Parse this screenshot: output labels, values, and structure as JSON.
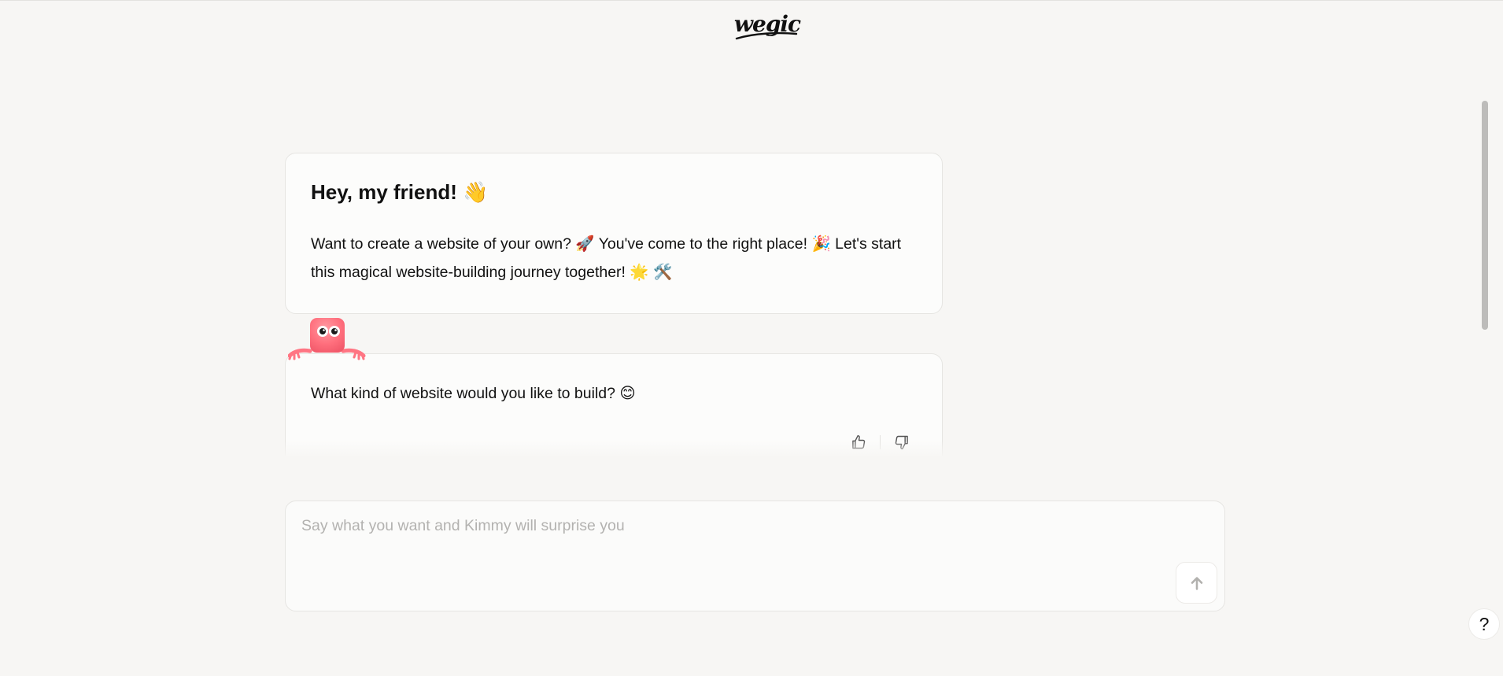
{
  "header": {
    "logo_text": "wegic"
  },
  "welcome": {
    "heading": "Hey, my friend! 👋",
    "body": "Want to create a website of your own? 🚀 You've come to the right place! 🎉 Let's start this magical website-building journey together! 🌟 🛠️"
  },
  "question": {
    "text": "What kind of website would you like to build? 😊"
  },
  "composer": {
    "placeholder": "Say what you want and Kimmy will surprise you",
    "value": ""
  },
  "help": {
    "label": "?"
  },
  "icons": {
    "thumbs_up": "thumbs-up-icon",
    "thumbs_down": "thumbs-down-icon",
    "send": "arrow-up-icon",
    "mascot": "pink-mascot"
  }
}
